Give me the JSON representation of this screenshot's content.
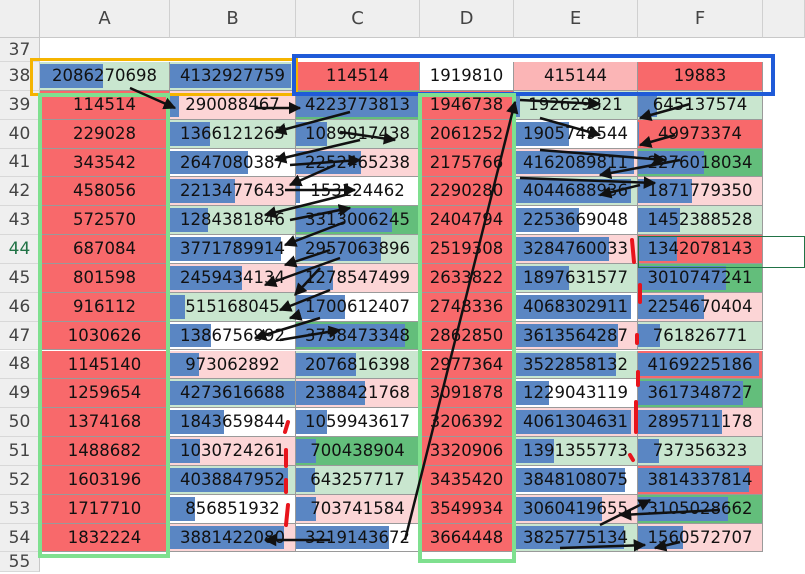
{
  "columns": [
    "A",
    "B",
    "C",
    "D",
    "E",
    "F"
  ],
  "rows": [
    37,
    38,
    39,
    40,
    41,
    42,
    43,
    44,
    45,
    46,
    47,
    48,
    49,
    50,
    51,
    52,
    53,
    54,
    55
  ],
  "active_row": 44,
  "colors": {
    "red": "#f8696b",
    "pink": "#fbb5b6",
    "light_pink": "#fcd5d6",
    "green": "#63be7b",
    "light_green": "#c9e6cf",
    "blue_bar": "#5a86c3",
    "white": "#ffffff",
    "border_yellow": "#f5b400",
    "border_blue": "#1f5bd8",
    "border_green": "#7fe08f",
    "arrow": "#111111",
    "mark_red": "#e8141c"
  },
  "cells": {
    "38": {
      "A": "2086270698",
      "B": "4132927759",
      "C": "114514",
      "D": "1919810",
      "E": "415144",
      "F": "19883"
    },
    "39": {
      "A": "114514",
      "B": "290088467",
      "C": "4223773813",
      "D": "1946738",
      "E": "192629321",
      "F": "645137574"
    },
    "40": {
      "A": "229028",
      "B": "1366121265",
      "C": "1089017438",
      "D": "2061252",
      "E": "1905749544",
      "F": "49973374"
    },
    "41": {
      "A": "343542",
      "B": "2647080387",
      "C": "2252465238",
      "D": "2175766",
      "E": "4162089811",
      "F": "2276018034"
    },
    "42": {
      "A": "458056",
      "B": "2213477643",
      "C": "153124462",
      "D": "2290280",
      "E": "4044688936",
      "F": "1871779350"
    },
    "43": {
      "A": "572570",
      "B": "1284381846",
      "C": "3313006245",
      "D": "2404794",
      "E": "2253669048",
      "F": "1452388528"
    },
    "44": {
      "A": "687084",
      "B": "3771789914",
      "C": "2957063896",
      "D": "2519308",
      "E": "3284760033",
      "F": "1342078143"
    },
    "45": {
      "A": "801598",
      "B": "2459434134",
      "C": "1278547499",
      "D": "2633822",
      "E": "1897631577",
      "F": "3010747241"
    },
    "46": {
      "A": "916112",
      "B": "515168045",
      "C": "1700612407",
      "D": "2748336",
      "E": "4068302911",
      "F": "2254670404"
    },
    "47": {
      "A": "1030626",
      "B": "1386756992",
      "C": "3758473348",
      "D": "2862850",
      "E": "3613564287",
      "F": "761826771"
    },
    "48": {
      "A": "1145140",
      "B": "973062892",
      "C": "2076816398",
      "D": "2977364",
      "E": "3522858132",
      "F": "4169225186"
    },
    "49": {
      "A": "1259654",
      "B": "4273616688",
      "C": "2388421768",
      "D": "3091878",
      "E": "1229043119",
      "F": "3617348727"
    },
    "50": {
      "A": "1374168",
      "B": "1843659844",
      "C": "1059943617",
      "D": "3206392",
      "E": "4061304631",
      "F": "2895711178"
    },
    "51": {
      "A": "1488682",
      "B": "1030724261",
      "C": "700438904",
      "D": "3320906",
      "E": "1391355773",
      "F": "737356323"
    },
    "52": {
      "A": "1603196",
      "B": "4038847952",
      "C": "643257717",
      "D": "3435420",
      "E": "3848108075",
      "F": "3814337814"
    },
    "53": {
      "A": "1717710",
      "B": "856851932",
      "C": "703741584",
      "D": "3549934",
      "E": "3060419655",
      "F": "3105028662"
    },
    "54": {
      "A": "1832224",
      "B": "3881422080",
      "C": "3219143672",
      "D": "3664448",
      "E": "3825775134",
      "F": "1560572707"
    }
  }
}
